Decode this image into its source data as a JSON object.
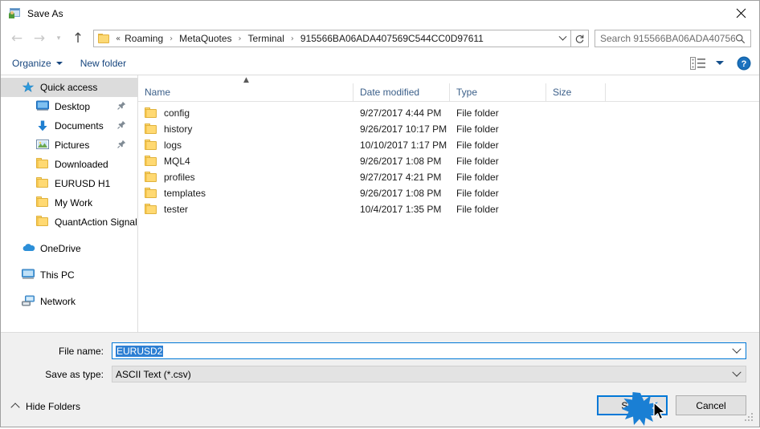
{
  "window": {
    "title": "Save As",
    "icon": "save-as-window-icon",
    "close_label": "✕"
  },
  "navigation": {
    "back_icon": "back-arrow-icon",
    "forward_icon": "forward-arrow-icon",
    "recent_icon": "recent-locations-chevron-icon",
    "up_icon": "up-arrow-icon",
    "back_enabled": false,
    "forward_enabled": false,
    "up_enabled": true
  },
  "breadcrumb": {
    "folder_icon": "folder-icon",
    "overflow": "«",
    "items": [
      "Roaming",
      "MetaQuotes",
      "Terminal",
      "915566BA06ADA407569C544CC0D97611"
    ],
    "separator": "›",
    "dropdown_icon": "chevron-down-icon",
    "refresh_icon": "refresh-icon"
  },
  "search": {
    "placeholder": "Search 915566BA06ADA40756...",
    "icon": "search-icon"
  },
  "toolbar": {
    "organize_label": "Organize",
    "new_folder_label": "New folder",
    "view_icon": "view-layout-icon",
    "view_chevron_icon": "chevron-down-icon",
    "help_icon": "help-icon",
    "help_label": "?"
  },
  "sidebar": {
    "items": [
      {
        "label": "Quick access",
        "icon": "star-icon",
        "indent": "root",
        "selected": true,
        "pinned": false
      },
      {
        "label": "Desktop",
        "icon": "desktop-icon",
        "indent": "child",
        "selected": false,
        "pinned": true
      },
      {
        "label": "Documents",
        "icon": "documents-download-icon",
        "indent": "child",
        "selected": false,
        "pinned": true
      },
      {
        "label": "Pictures",
        "icon": "pictures-icon",
        "indent": "child",
        "selected": false,
        "pinned": true
      },
      {
        "label": "Downloaded",
        "icon": "folder-icon",
        "indent": "child",
        "selected": false,
        "pinned": false
      },
      {
        "label": "EURUSD H1",
        "icon": "folder-icon",
        "indent": "child",
        "selected": false,
        "pinned": false
      },
      {
        "label": "My Work",
        "icon": "folder-icon",
        "indent": "child",
        "selected": false,
        "pinned": false
      },
      {
        "label": "QuantAction Signal",
        "icon": "folder-icon",
        "indent": "child",
        "selected": false,
        "pinned": false
      },
      {
        "label": "OneDrive",
        "icon": "onedrive-icon",
        "indent": "root",
        "selected": false,
        "pinned": false,
        "gap": true
      },
      {
        "label": "This PC",
        "icon": "this-pc-icon",
        "indent": "root",
        "selected": false,
        "pinned": false,
        "gap": true
      },
      {
        "label": "Network",
        "icon": "network-icon",
        "indent": "root",
        "selected": false,
        "pinned": false,
        "gap": true
      }
    ]
  },
  "filelist": {
    "columns": [
      "Name",
      "Date modified",
      "Type",
      "Size"
    ],
    "sort_column": "Name",
    "sort_direction": "ascending",
    "sort_icon": "sort-ascending-icon",
    "rows": [
      {
        "name": "config",
        "date": "9/27/2017 4:44 PM",
        "type": "File folder",
        "size": "",
        "icon": "folder-icon"
      },
      {
        "name": "history",
        "date": "9/26/2017 10:17 PM",
        "type": "File folder",
        "size": "",
        "icon": "folder-icon"
      },
      {
        "name": "logs",
        "date": "10/10/2017 1:17 PM",
        "type": "File folder",
        "size": "",
        "icon": "folder-icon"
      },
      {
        "name": "MQL4",
        "date": "9/26/2017 1:08 PM",
        "type": "File folder",
        "size": "",
        "icon": "folder-icon"
      },
      {
        "name": "profiles",
        "date": "9/27/2017 4:21 PM",
        "type": "File folder",
        "size": "",
        "icon": "folder-icon"
      },
      {
        "name": "templates",
        "date": "9/26/2017 1:08 PM",
        "type": "File folder",
        "size": "",
        "icon": "folder-icon"
      },
      {
        "name": "tester",
        "date": "10/4/2017 1:35 PM",
        "type": "File folder",
        "size": "",
        "icon": "folder-icon"
      }
    ]
  },
  "form": {
    "file_name_label": "File name:",
    "file_name_value": "EURUSD2",
    "file_name_selected": true,
    "save_as_type_label": "Save as type:",
    "save_as_type_value": "ASCII Text (*.csv)",
    "dropdown_icon": "chevron-down-icon"
  },
  "footer": {
    "hide_folders_label": "Hide Folders",
    "hide_folders_icon": "chevron-up-icon",
    "save_label": "Save",
    "cancel_label": "Cancel",
    "resize_grip_icon": "resize-grip-icon"
  },
  "pointer": {
    "click_burst_icon": "click-burst-icon",
    "cursor_icon": "mouse-pointer-icon",
    "burst_color": "#1a7fd4",
    "target": "save-button"
  },
  "colors": {
    "accent": "#0078d7",
    "folder": "#ffd972",
    "header_text": "#3b5f89",
    "selection": "#2d7fd3",
    "toolbar_link": "#16457e"
  }
}
